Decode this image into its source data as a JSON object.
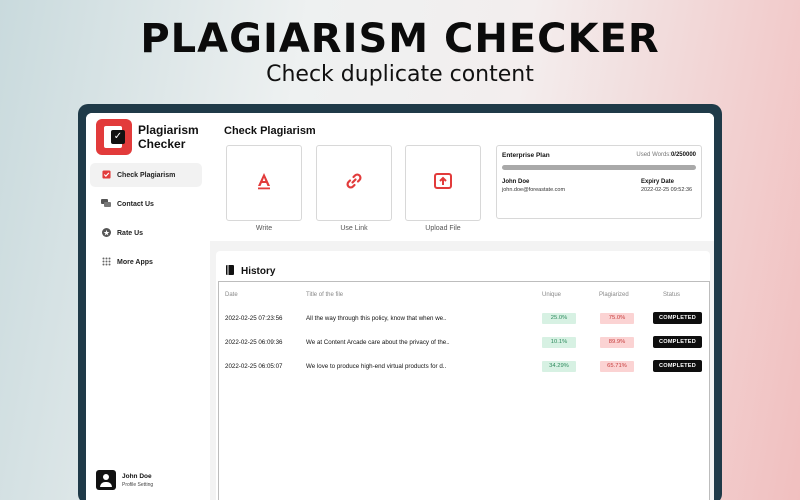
{
  "hero": {
    "title": "PLAGIARISM CHECKER",
    "subtitle": "Check duplicate content"
  },
  "sidebar": {
    "app_name": "Plagiarism Checker",
    "items": [
      {
        "label": "Check Plagiarism",
        "icon": "check-square-icon",
        "active": true
      },
      {
        "label": "Contact Us",
        "icon": "chat-icon",
        "active": false
      },
      {
        "label": "Rate Us",
        "icon": "star-icon",
        "active": false
      },
      {
        "label": "More Apps",
        "icon": "grid-icon",
        "active": false
      }
    ],
    "profile": {
      "name": "John Doe",
      "subtitle": "Profile Setting"
    }
  },
  "main": {
    "title": "Check Plagiarism",
    "actions": [
      {
        "label": "Write",
        "icon": "write-icon"
      },
      {
        "label": "Use Link",
        "icon": "link-icon"
      },
      {
        "label": "Upload File",
        "icon": "upload-icon"
      }
    ],
    "plan": {
      "name": "Enterprise Plan",
      "used_label": "Used Words:",
      "used_value": "0/250000",
      "user_name": "John Doe",
      "email": "john.doe@foreastate.com",
      "expiry_label": "Expiry Date",
      "expiry_value": "2022-02-25 09:52:36"
    }
  },
  "history": {
    "title": "History",
    "columns": [
      "Date",
      "Title of the file",
      "Unique",
      "Plagiarized",
      "Status"
    ],
    "rows": [
      {
        "date": "2022-02-25 07:23:56",
        "title": "All the way through this policy, know that when we..",
        "unique": "25.0%",
        "plagiarized": "75.0%",
        "status": "COMPLETED"
      },
      {
        "date": "2022-02-25 06:09:36",
        "title": "We at Content Arcade care about the privacy of the..",
        "unique": "10.1%",
        "plagiarized": "89.9%",
        "status": "COMPLETED"
      },
      {
        "date": "2022-02-25 06:05:07",
        "title": "We love to produce high-end virtual products for d..",
        "unique": "34.29%",
        "plagiarized": "65.71%",
        "status": "COMPLETED"
      }
    ]
  },
  "colors": {
    "accent": "#e23b3b",
    "device_frame": "#1f3a48",
    "unique_bg": "#d7f1e3",
    "plag_bg": "#fbd3d3"
  }
}
